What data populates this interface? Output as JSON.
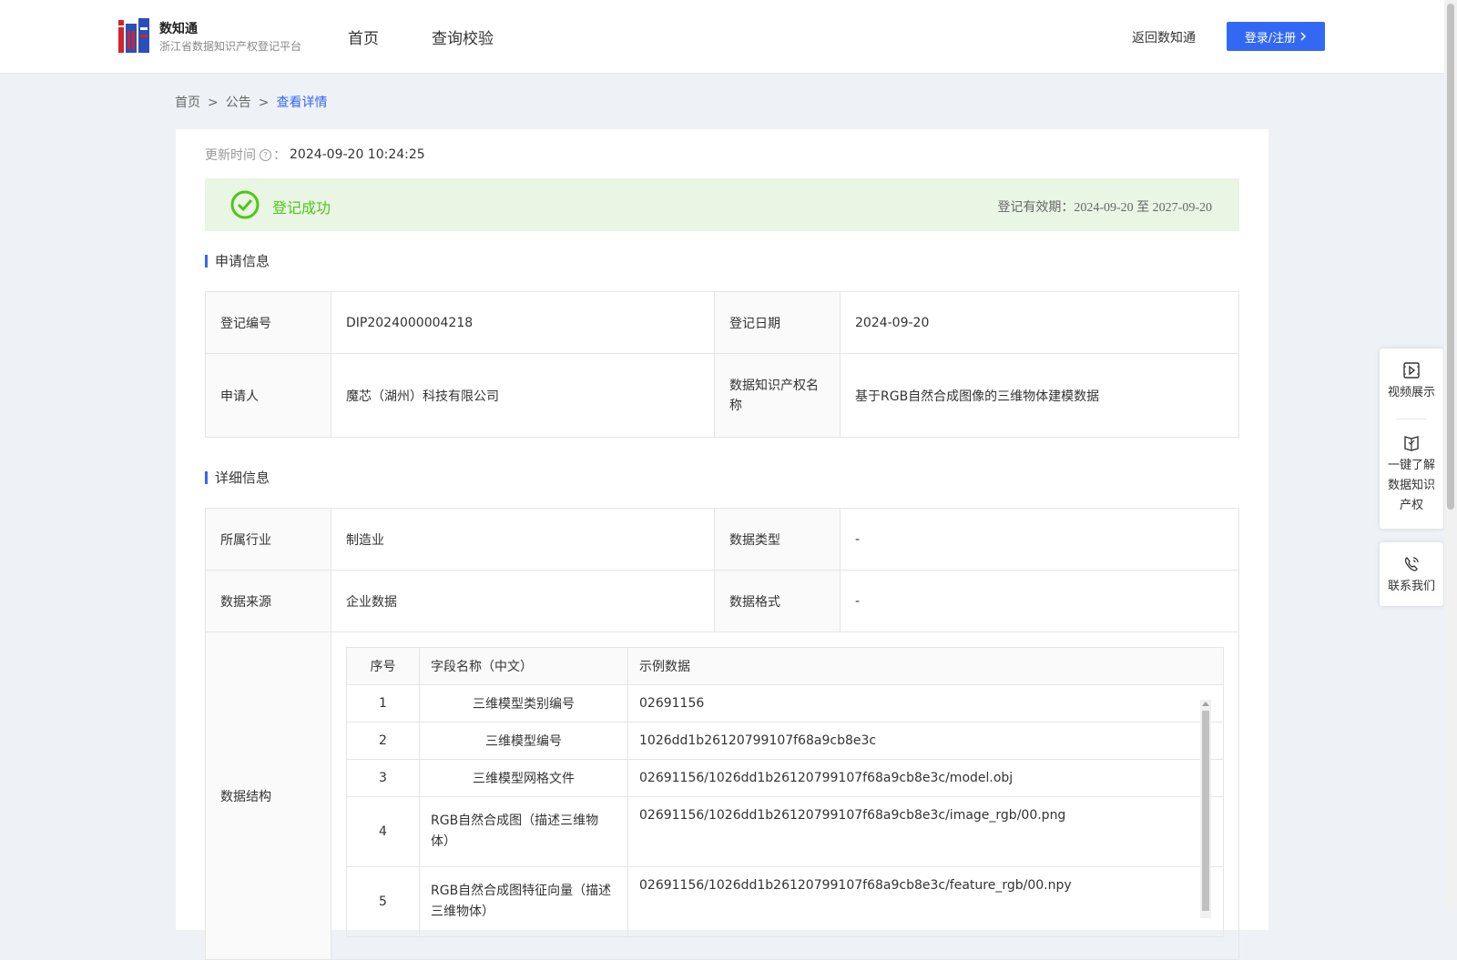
{
  "header": {
    "brand_title": "数知通",
    "brand_subtitle": "浙江省数据知识产权登记平台",
    "nav": [
      "首页",
      "查询校验"
    ],
    "back_link": "返回数知通",
    "login_button": "登录/注册"
  },
  "breadcrumb": {
    "items": [
      "首页",
      "公告"
    ],
    "separator": ">",
    "current": "查看详情"
  },
  "update": {
    "label": "更新时间",
    "colon": "：",
    "value": "2024-09-20 10:24:25"
  },
  "status": {
    "text": "登记成功",
    "validity_label": "登记有效期：",
    "validity_dates": "2024-09-20 至 2027-09-20",
    "color": "#52c41a"
  },
  "application": {
    "title": "申请信息",
    "rows": [
      {
        "label1": "登记编号",
        "value1": "DIP2024000004218",
        "label2": "登记日期",
        "value2": "2024-09-20"
      },
      {
        "label1": "申请人",
        "value1": "魔芯（湖州）科技有限公司",
        "label2": "数据知识产权名称",
        "value2": "基于RGB自然合成图像的三维物体建模数据"
      }
    ]
  },
  "details": {
    "title": "详细信息",
    "rows": [
      {
        "label1": "所属行业",
        "value1": "制造业",
        "label2": "数据类型",
        "value2": "-"
      },
      {
        "label1": "数据来源",
        "value1": "企业数据",
        "label2": "数据格式",
        "value2": "-"
      }
    ],
    "structure_label": "数据结构",
    "structure": {
      "headers": [
        "序号",
        "字段名称（中文）",
        "示例数据"
      ],
      "rows": [
        {
          "no": "1",
          "name": "三维模型类别编号",
          "sample": "02691156"
        },
        {
          "no": "2",
          "name": "三维模型编号",
          "sample": "1026dd1b26120799107f68a9cb8e3c"
        },
        {
          "no": "3",
          "name": "三维模型网格文件",
          "sample": "02691156/1026dd1b26120799107f68a9cb8e3c/model.obj"
        },
        {
          "no": "4",
          "name": "RGB自然合成图（描述三维物体）",
          "sample": "02691156/1026dd1b26120799107f68a9cb8e3c/image_rgb/00.png"
        },
        {
          "no": "5",
          "name": "RGB自然合成图特征向量（描述三维物体）",
          "sample": "02691156/1026dd1b26120799107f68a9cb8e3c/feature_rgb/00.npy"
        }
      ]
    }
  },
  "float_panel": {
    "video": "视频展示",
    "learn_ip": "一键了解数据知识产权",
    "contact": "联系我们"
  },
  "colors": {
    "accent": "#3368f5",
    "success_bg": "#e8f6e3"
  }
}
